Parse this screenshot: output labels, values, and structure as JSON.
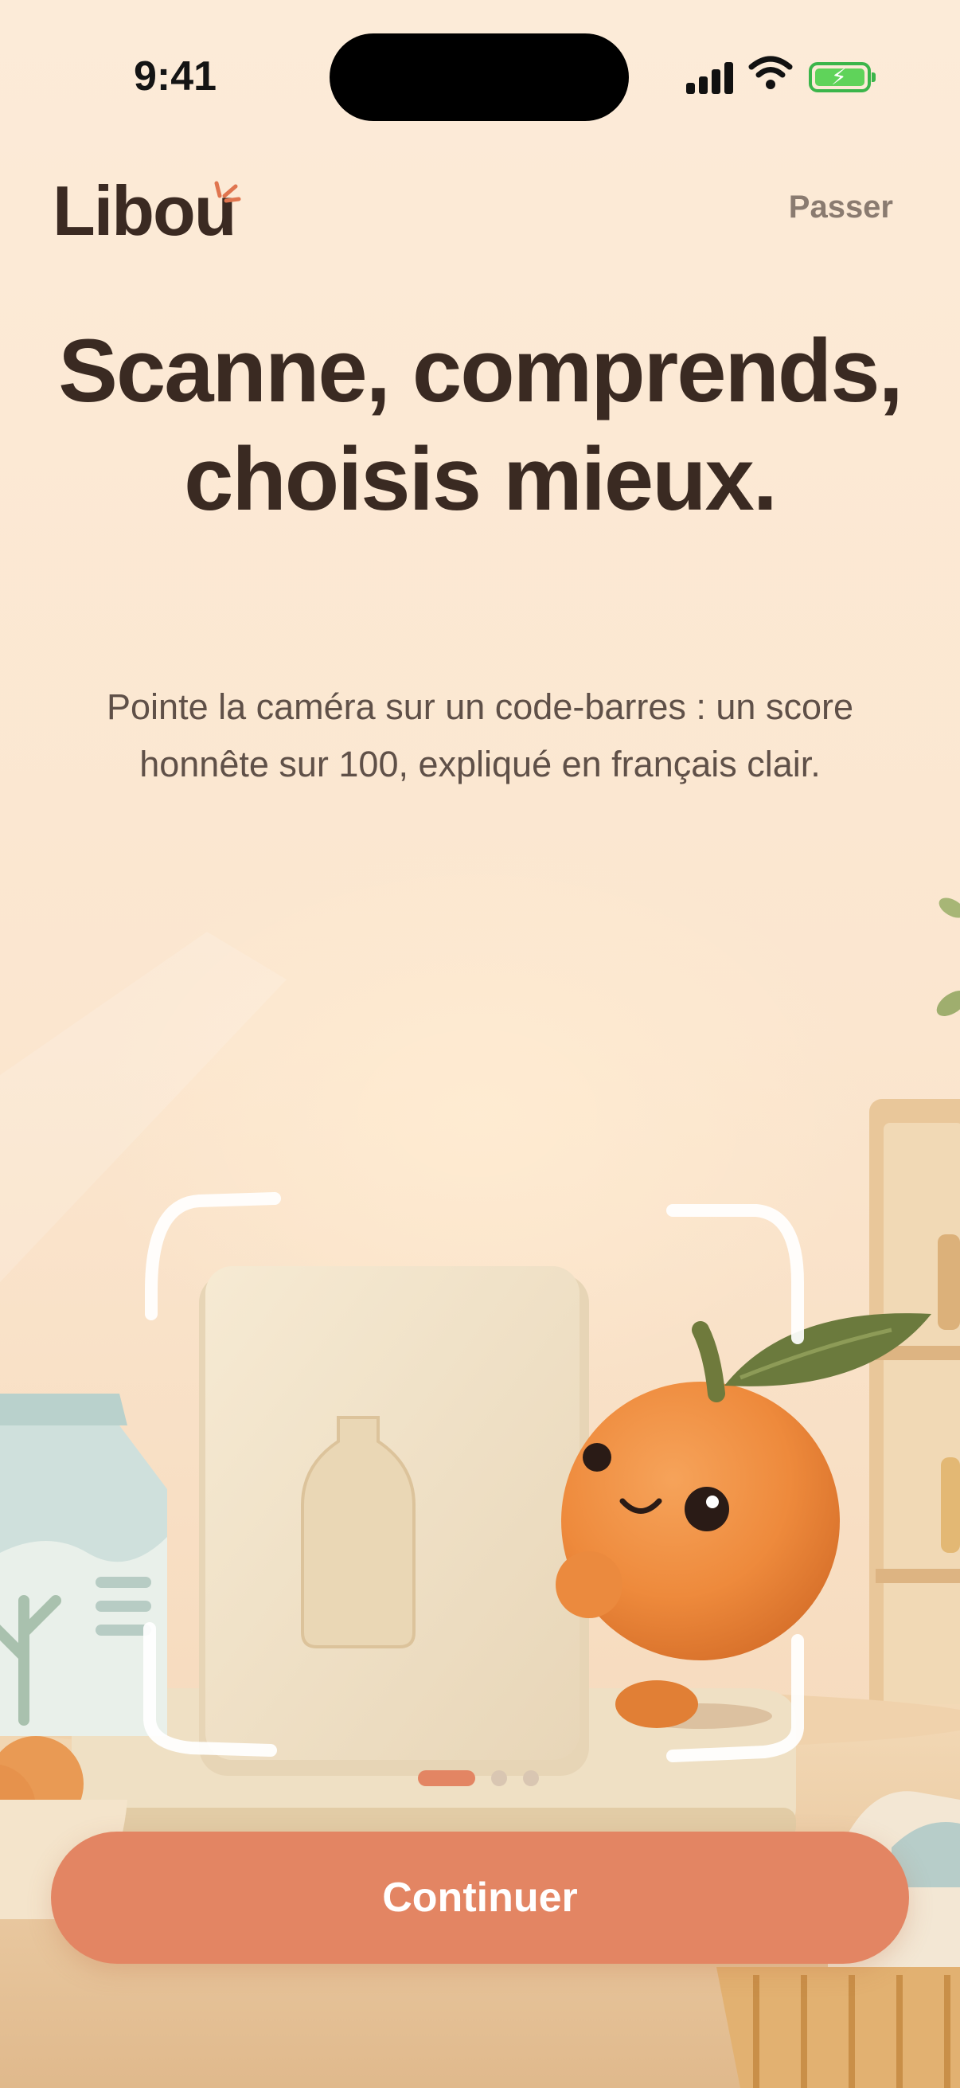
{
  "status_bar": {
    "time": "9:41"
  },
  "header": {
    "logo": "Libou",
    "skip_label": "Passer"
  },
  "headline": "Scanne, comprends, choisis mieux.",
  "subtitle": "Pointe la caméra sur un code-barres : un score honnête sur 100, expliqué en français clair.",
  "pagination": {
    "current": 1,
    "total": 3
  },
  "cta": {
    "label": "Continuer"
  },
  "colors": {
    "accent": "#e38563",
    "text": "#3a2a22",
    "background": "#fcebd8"
  }
}
